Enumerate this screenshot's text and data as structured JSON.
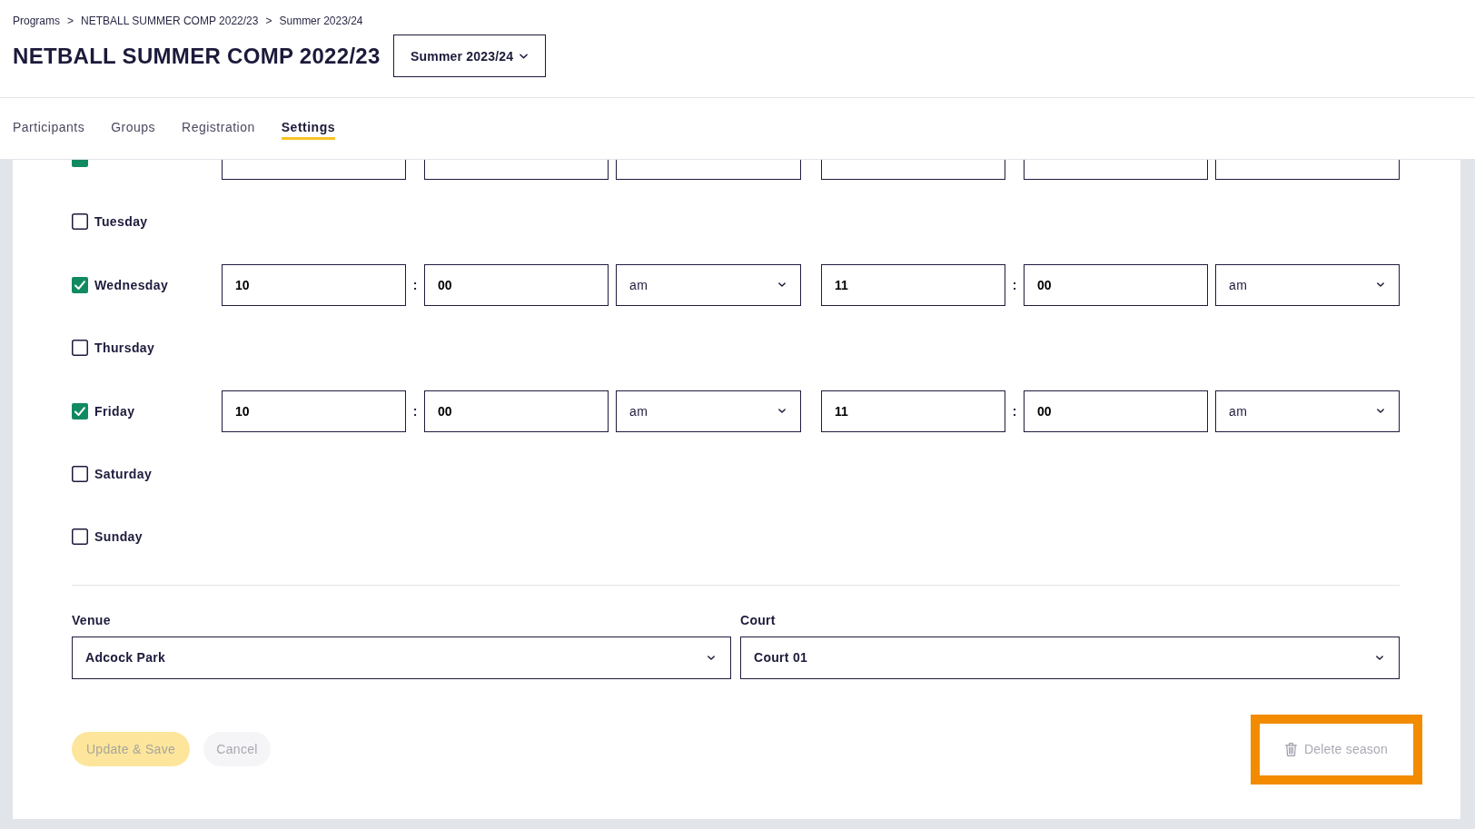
{
  "breadcrumb": {
    "items": [
      "Programs",
      "NETBALL SUMMER COMP 2022/23",
      "Summer 2023/24"
    ],
    "separators": [
      ">",
      ">"
    ]
  },
  "title": "NETBALL SUMMER COMP 2022/23",
  "season_select": {
    "value": "Summer 2023/24"
  },
  "tabs": [
    {
      "label": "Participants",
      "selected": false
    },
    {
      "label": "Groups",
      "selected": false
    },
    {
      "label": "Registration",
      "selected": false
    },
    {
      "label": "Settings",
      "selected": true
    }
  ],
  "schedule": [
    {
      "kind": "clipped",
      "checked": true
    },
    {
      "kind": "day",
      "day": "Tuesday",
      "checked": false
    },
    {
      "kind": "day",
      "day": "Wednesday",
      "checked": true,
      "start": {
        "hour": "10",
        "separator": ":",
        "minute": "00",
        "period": "am"
      },
      "end": {
        "hour": "11",
        "separator": ":",
        "minute": "00",
        "period": "am"
      }
    },
    {
      "kind": "day",
      "day": "Thursday",
      "checked": false
    },
    {
      "kind": "day",
      "day": "Friday",
      "checked": true,
      "start": {
        "hour": "10",
        "separator": ":",
        "minute": "00",
        "period": "am"
      },
      "end": {
        "hour": "11",
        "separator": ":",
        "minute": "00",
        "period": "am"
      }
    },
    {
      "kind": "day",
      "day": "Saturday",
      "checked": false
    },
    {
      "kind": "day",
      "day": "Sunday",
      "checked": false
    }
  ],
  "selects": [
    {
      "label": "Venue",
      "value": "Adcock Park"
    },
    {
      "label": "Court",
      "value": "Court 01"
    }
  ],
  "actions": {
    "save": {
      "label": "Update & Save",
      "disabled": true
    },
    "cancel": {
      "label": "Cancel",
      "disabled": true
    },
    "delete": {
      "label": "Delete season",
      "disabled": true,
      "highlighted": true
    }
  }
}
